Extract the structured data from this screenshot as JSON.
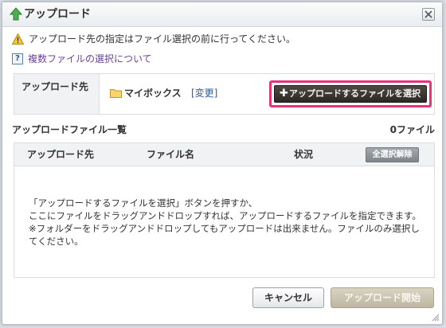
{
  "dialog": {
    "title": "アップロード",
    "icons": {
      "title": "upload-arrow-icon",
      "close": "close-icon"
    }
  },
  "notice": {
    "icon": "warning-icon",
    "text": "アップロード先の指定はファイル選択の前に行ってください。"
  },
  "help": {
    "icon": "help-icon",
    "icon_glyph": "?",
    "link_text": "複数ファイルの選択について"
  },
  "destination": {
    "label": "アップロード先",
    "folder_icon": "folder-icon",
    "folder_name": "マイボックス",
    "change_link": "[変更]",
    "select_button": "アップロードするファイルを選択",
    "select_button_icon": "plus-icon"
  },
  "file_list": {
    "title": "アップロードファイル一覧",
    "count": "0ファイル",
    "columns": [
      "アップロード先",
      "ファイル名",
      "状況"
    ],
    "clear_all_button": "全選択解除",
    "empty_message": [
      "「アップロードするファイルを選択」ボタンを押すか、",
      "ここにファイルをドラッグアンドドロップすれば、アップロードするファイルを指定できます。",
      "※フォルダーをドラッグアンドドロップしてもアップロードは出来ません。ファイルのみ選択してください。"
    ]
  },
  "actions": {
    "cancel": "キャンセル",
    "start": "アップロード開始"
  },
  "colors": {
    "highlight": "#e6337a",
    "link_purple": "#6d3f9c",
    "link_blue": "#2a5a9a",
    "select_button_bg": "#2b2824",
    "start_button_bg": "#bdb6a2",
    "upload_arrow": "#4caf50"
  }
}
